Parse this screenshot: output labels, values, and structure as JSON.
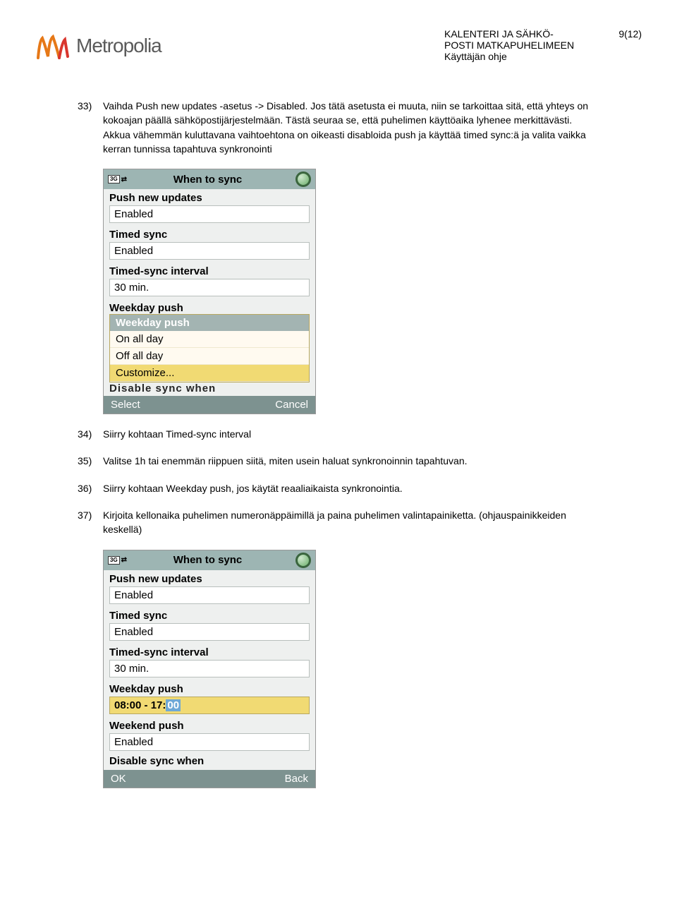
{
  "header": {
    "logo_text": "Metropolia",
    "doc_title_line1": "KALENTERI JA SÄHKÖ-",
    "doc_title_line2": "POSTI MATKAPUHELIMEEN",
    "doc_title_line3": "Käyttäjän ohje",
    "page_number": "9(12)"
  },
  "steps": {
    "s33_num": "33)",
    "s33_text": "Vaihda Push new updates -asetus -> Disabled. Jos tätä asetusta ei muuta, niin se tarkoittaa sitä, että yhteys on kokoajan päällä sähköpostijärjestelmään. Tästä seuraa se, että puhelimen käyttöaika lyhenee merkittävästi. Akkua vähemmän kuluttavana vaihtoehtona on oikeasti disabloida push ja käyttää timed sync:ä ja valita vaikka kerran tunnissa tapahtuva synkronointi",
    "s34_num": "34)",
    "s34_text": "Siirry kohtaan Timed-sync interval",
    "s35_num": "35)",
    "s35_text": "Valitse 1h tai enemmän riippuen siitä, miten usein haluat synkronoinnin tapahtuvan.",
    "s36_num": "36)",
    "s36_text": "Siirry kohtaan Weekday push, jos käytät reaaliaikaista synkronointia.",
    "s37_num": "37)",
    "s37_text": "Kirjoita kellonaika puhelimen numeronäppäimillä ja paina puhelimen valintapainiketta. (ohjauspainikkeiden keskellä)"
  },
  "phone1": {
    "status_3g": "3G",
    "title": "When to sync",
    "labels": {
      "push": "Push new updates",
      "timed": "Timed sync",
      "interval": "Timed-sync interval",
      "weekday": "Weekday push"
    },
    "values": {
      "push": "Enabled",
      "timed": "Enabled",
      "interval": "30 min."
    },
    "popup": {
      "header": "Weekday push",
      "opt1": "On all day",
      "opt2": "Off all day",
      "opt3": "Customize..."
    },
    "hidden_row": "Disable sync when",
    "softkeys": {
      "left": "Select",
      "right": "Cancel"
    }
  },
  "phone2": {
    "status_3g": "3G",
    "title": "When to sync",
    "labels": {
      "push": "Push new updates",
      "timed": "Timed sync",
      "interval": "Timed-sync interval",
      "weekday": "Weekday push",
      "weekend": "Weekend push",
      "disable": "Disable sync when"
    },
    "values": {
      "push": "Enabled",
      "timed": "Enabled",
      "interval": "30 min.",
      "weekday_prefix": "08:00 - 17:",
      "weekday_hl": "00",
      "weekend": "Enabled"
    },
    "softkeys": {
      "left": "OK",
      "right": "Back"
    }
  }
}
